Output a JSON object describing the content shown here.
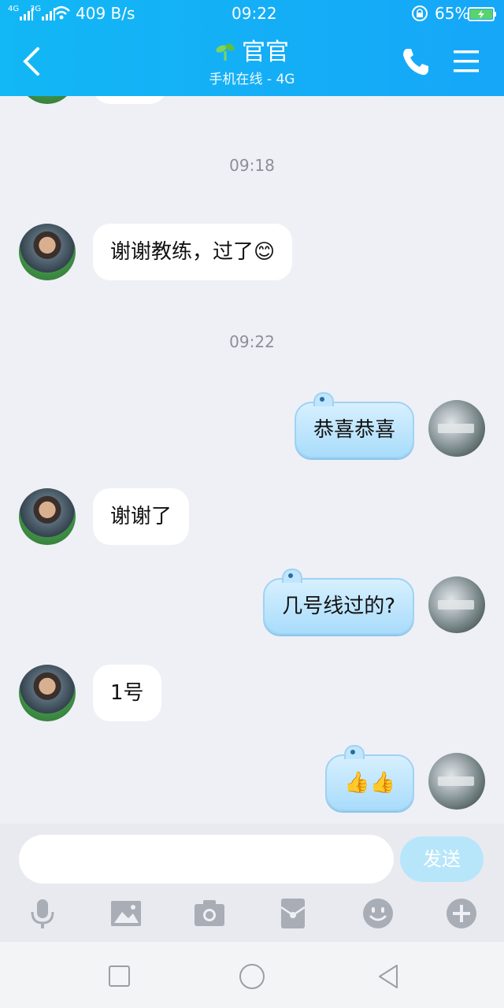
{
  "status_bar": {
    "signal_1": "4G",
    "signal_2": "3G",
    "speed": "409 B/s",
    "time": "09:22",
    "battery": "65%"
  },
  "header": {
    "title": "官官",
    "subtitle": "手机在线 - 4G"
  },
  "messages": [
    {
      "type": "time",
      "text": "09:18"
    },
    {
      "type": "in",
      "text": "谢谢教练，过了",
      "emoji": "😊"
    },
    {
      "type": "time",
      "text": "09:22"
    },
    {
      "type": "out",
      "text": "恭喜恭喜"
    },
    {
      "type": "in",
      "text": "谢谢了"
    },
    {
      "type": "out",
      "text": "几号线过的?"
    },
    {
      "type": "in",
      "text": "1号"
    },
    {
      "type": "out",
      "emoji": "👍👍"
    }
  ],
  "composer": {
    "send_label": "发送",
    "value": "",
    "placeholder": ""
  },
  "toolbar": [
    "microphone-icon",
    "image-icon",
    "camera-icon",
    "red-packet-icon",
    "emoji-icon",
    "plus-icon"
  ],
  "colors": {
    "accent": "#12b7f5",
    "bubble_out": "#a9dcfb",
    "send": "#b7e6fb"
  }
}
